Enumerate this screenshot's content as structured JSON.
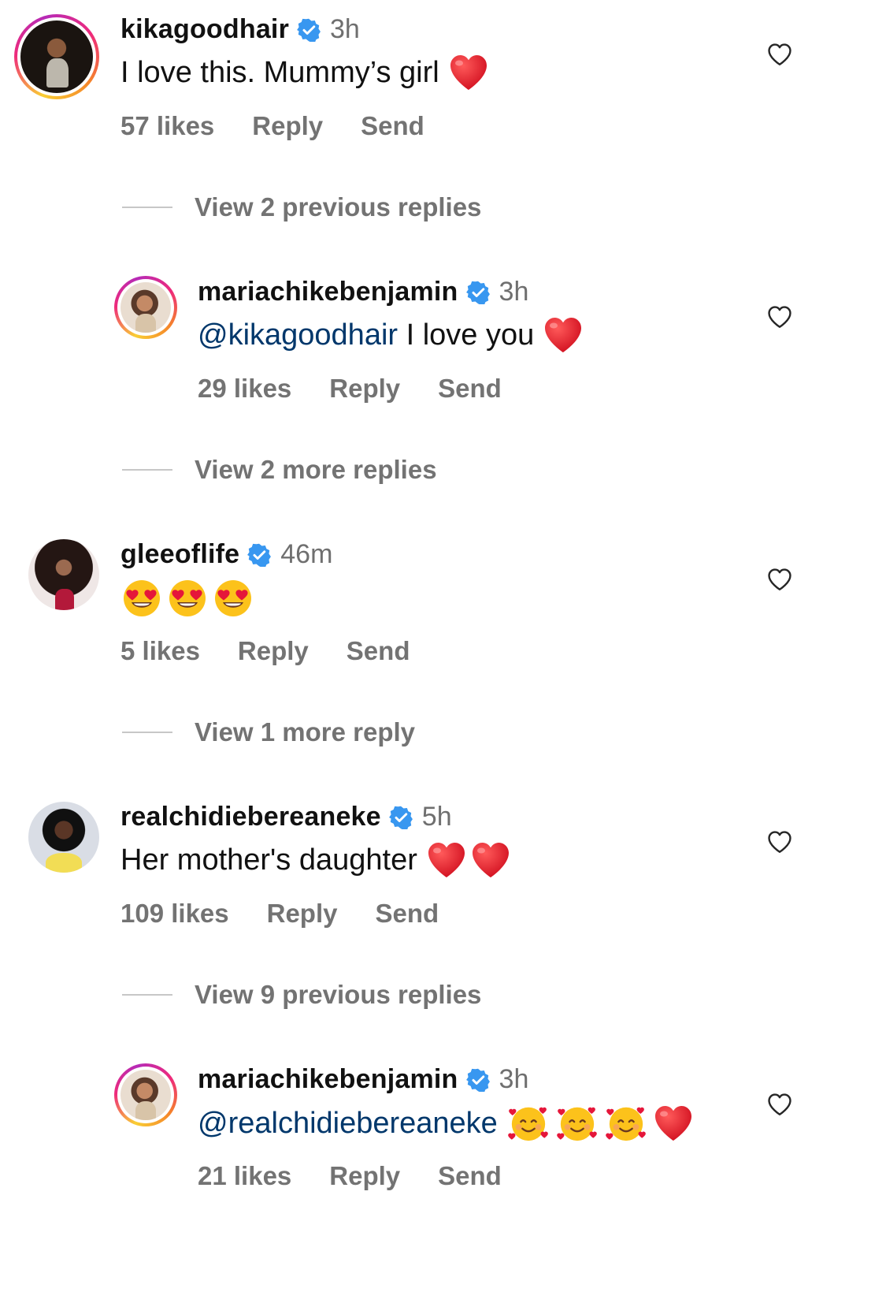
{
  "colors": {
    "text": "#111111",
    "muted": "#737373",
    "mention": "#00376b",
    "verified": "#3897f0",
    "heart": "#e0162b"
  },
  "comments": [
    {
      "username": "kikagoodhair",
      "time": "3h",
      "text": "I love this. Mummy’s girl",
      "likes": "57 likes",
      "reply": "Reply",
      "send": "Send",
      "emojis": [
        "red-heart"
      ]
    },
    {
      "username": "mariachikebenjamin",
      "time": "3h",
      "mention": "@kikagoodhair",
      "text": " I love you",
      "likes": "29 likes",
      "reply": "Reply",
      "send": "Send",
      "emojis": [
        "red-heart"
      ]
    },
    {
      "username": "gleeoflife",
      "time": "46m",
      "text": "",
      "likes": "5 likes",
      "reply": "Reply",
      "send": "Send",
      "emojis": [
        "heart-eyes",
        "heart-eyes",
        "heart-eyes"
      ]
    },
    {
      "username": "realchidiebereaneke",
      "time": "5h",
      "text": "Her mother's daughter",
      "likes": "109 likes",
      "reply": "Reply",
      "send": "Send",
      "emojis": [
        "red-heart",
        "red-heart"
      ]
    },
    {
      "username": "mariachikebenjamin",
      "time": "3h",
      "mention": "@realchidiebereaneke",
      "text": "",
      "likes": "21 likes",
      "reply": "Reply",
      "send": "Send",
      "emojis": [
        "smiling-hearts",
        "smiling-hearts",
        "smiling-hearts",
        "red-heart"
      ]
    }
  ],
  "view_replies": [
    "View 2 previous replies",
    "View 2 more replies",
    "View 1 more reply",
    "View 9 previous replies"
  ]
}
